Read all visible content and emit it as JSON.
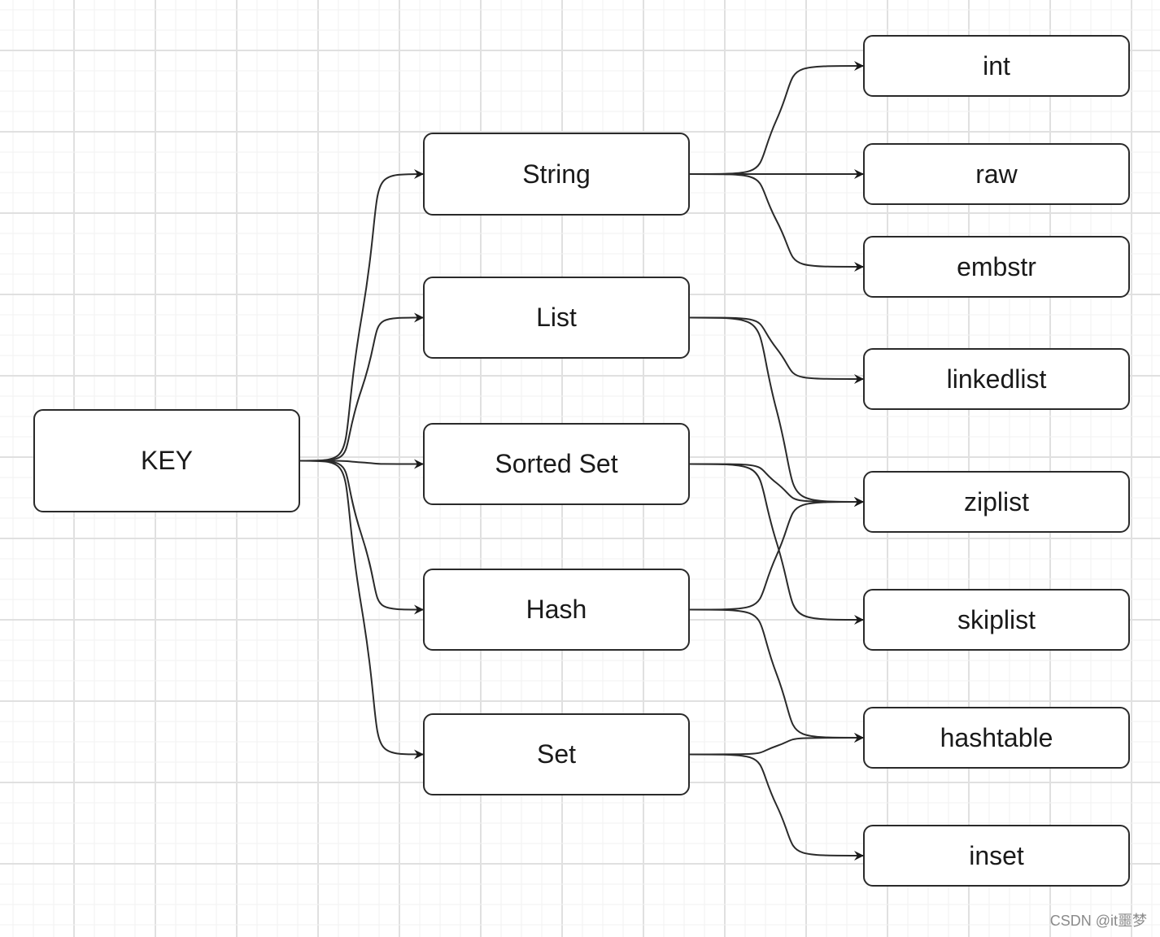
{
  "nodes": {
    "key": {
      "label": "KEY"
    },
    "string": {
      "label": "String"
    },
    "list": {
      "label": "List"
    },
    "sorted_set": {
      "label": "Sorted Set"
    },
    "hash": {
      "label": "Hash"
    },
    "set": {
      "label": "Set"
    },
    "int": {
      "label": "int"
    },
    "raw": {
      "label": "raw"
    },
    "embstr": {
      "label": "embstr"
    },
    "linkedlist": {
      "label": "linkedlist"
    },
    "ziplist": {
      "label": "ziplist"
    },
    "skiplist": {
      "label": "skiplist"
    },
    "hashtable": {
      "label": "hashtable"
    },
    "inset": {
      "label": "inset"
    }
  },
  "edges": [
    [
      "key",
      "string"
    ],
    [
      "key",
      "list"
    ],
    [
      "key",
      "sorted_set"
    ],
    [
      "key",
      "hash"
    ],
    [
      "key",
      "set"
    ],
    [
      "string",
      "int"
    ],
    [
      "string",
      "raw"
    ],
    [
      "string",
      "embstr"
    ],
    [
      "list",
      "linkedlist"
    ],
    [
      "list",
      "ziplist"
    ],
    [
      "sorted_set",
      "ziplist"
    ],
    [
      "sorted_set",
      "skiplist"
    ],
    [
      "hash",
      "ziplist"
    ],
    [
      "hash",
      "hashtable"
    ],
    [
      "set",
      "hashtable"
    ],
    [
      "set",
      "inset"
    ]
  ],
  "watermark": "CSDN @it噩梦",
  "colors": {
    "stroke": "#2a2a2a",
    "grid": "#e6e6e6"
  }
}
